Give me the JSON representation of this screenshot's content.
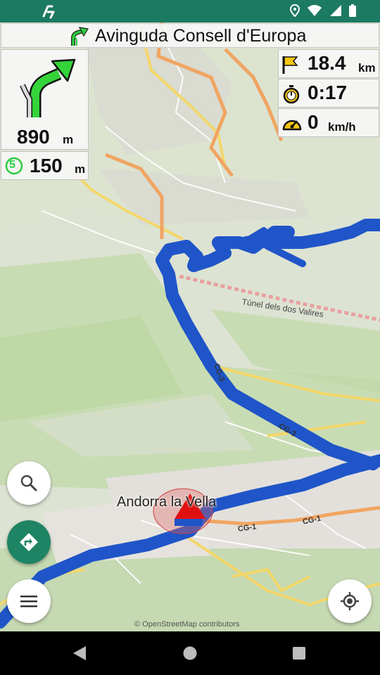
{
  "status_bar": {
    "app_icon": "app-logo-icon",
    "icons": [
      "location-pin-icon",
      "wifi-icon",
      "cell-signal-icon",
      "battery-icon"
    ],
    "color": "#1d7a62"
  },
  "street": {
    "name": "Avinguda Consell d'Europa",
    "icon": "keep-right-turn-icon"
  },
  "next_turn": {
    "distance": "890",
    "unit": "m",
    "icon": "keep-right-turn-icon"
  },
  "exit_info": {
    "exit_number": "5",
    "distance": "150",
    "unit": "m"
  },
  "trip_info": {
    "remaining_distance": "18.4",
    "remaining_distance_unit": "km",
    "remaining_time": "0:17",
    "speed": "0",
    "speed_unit": "km/h"
  },
  "map": {
    "town_label": "Andorra la Vella",
    "tunnel_label": "Túnel dels dos Valires",
    "road_labels": [
      "CG-3",
      "CG-3",
      "CG-1",
      "CG-1"
    ],
    "attribution": "© OpenStreetMap contributors",
    "route_color": "#1f55c8",
    "position_marker_color": "#e01010"
  },
  "buttons": {
    "search": "search-icon",
    "directions": "directions-icon",
    "menu": "menu-icon",
    "my_location": "my-location-icon"
  },
  "system_nav": [
    "back-icon",
    "home-icon",
    "recents-icon"
  ]
}
